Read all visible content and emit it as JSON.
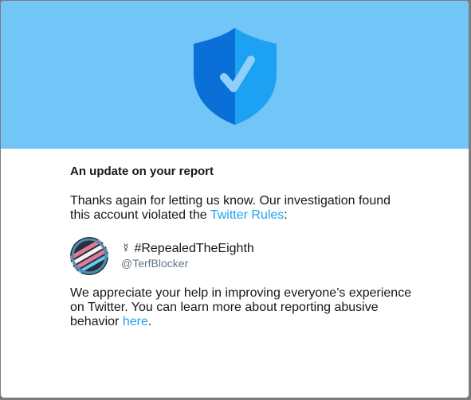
{
  "banner": {
    "color": "#71c5f7",
    "icon": "shield-check-icon"
  },
  "report": {
    "heading": "An update on your report",
    "intro_text": "Thanks again for letting us know. Our investigation found this account violated the ",
    "rules_link": "Twitter Rules",
    "intro_end": ":",
    "account": {
      "avatar_icon": "avatar-striped-icon",
      "display_name": "☿ #RepealedTheEighth",
      "handle": "@TerfBlocker"
    },
    "closing_text": "We appreciate your help in improving everyone’s experience on Twitter. You can learn more about reporting abusive behavior ",
    "here_link": "here",
    "closing_end": "."
  },
  "colors": {
    "link": "#1da1f2",
    "text": "#14171a",
    "secondary_text": "#657786"
  }
}
